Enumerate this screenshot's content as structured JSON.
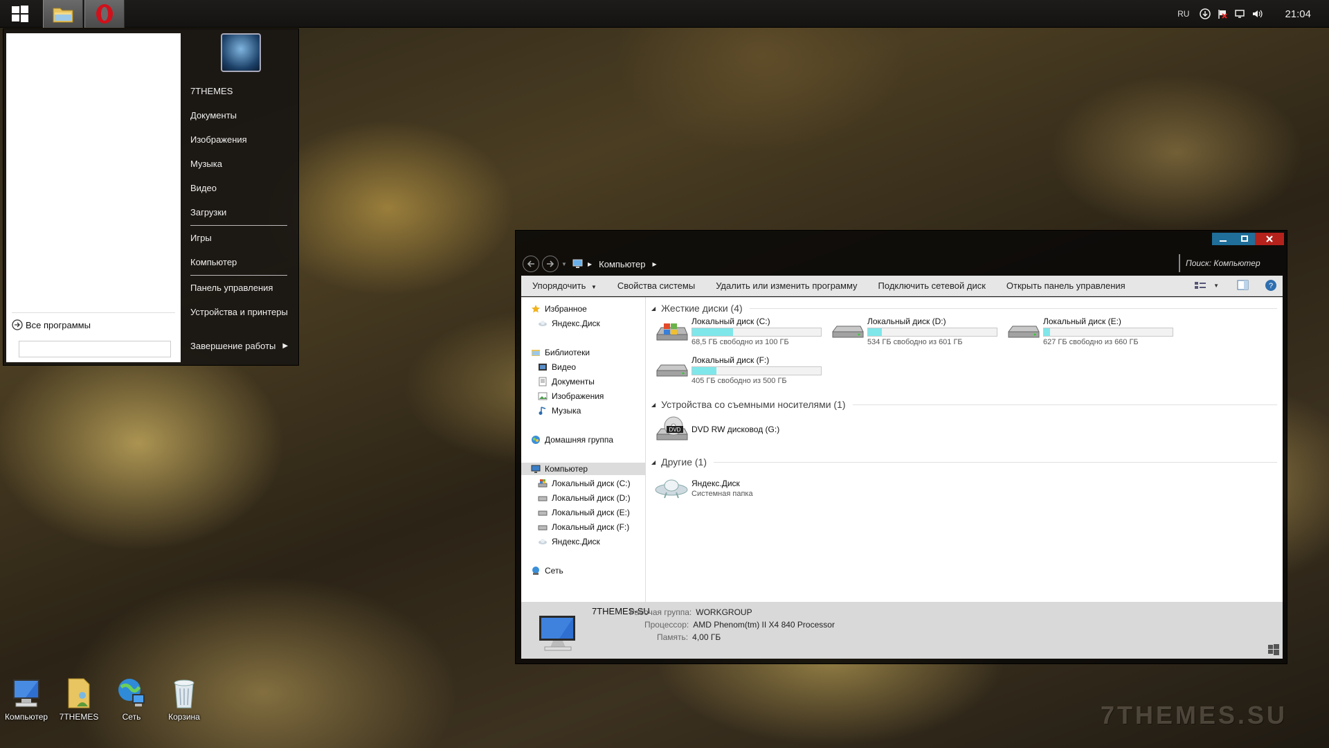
{
  "taskbar": {
    "pinned": [
      {
        "name": "explorer-taskbar-button",
        "icon": "folder-icon"
      },
      {
        "name": "opera-taskbar-button",
        "icon": "opera-icon"
      }
    ],
    "tray": {
      "language": "RU",
      "icons": [
        "download-icon",
        "action-center-flag-icon",
        "network-icon",
        "volume-icon"
      ],
      "clock": "21:04"
    }
  },
  "start_menu": {
    "all_programs": "Все программы",
    "search_placeholder": "",
    "user_name": "7THEMES",
    "items": {
      "documents": "Документы",
      "pictures": "Изображения",
      "music": "Музыка",
      "video": "Видео",
      "downloads": "Загрузки",
      "games": "Игры",
      "computer": "Компьютер",
      "control_panel": "Панель управления",
      "devices": "Устройства и принтеры",
      "shutdown": "Завершение работы"
    }
  },
  "explorer": {
    "breadcrumb": "Компьютер",
    "search_placeholder": "Поиск: Компьютер",
    "toolbar": {
      "organize": "Упорядочить",
      "system_properties": "Свойства системы",
      "uninstall": "Удалить или изменить программу",
      "map_drive": "Подключить сетевой диск",
      "control_panel": "Открыть панель управления"
    },
    "nav": {
      "favorites": "Избранное",
      "yandex_disk": "Яндекс.Диск",
      "libraries": "Библиотеки",
      "video": "Видео",
      "documents": "Документы",
      "pictures": "Изображения",
      "music": "Музыка",
      "homegroup": "Домашняя группа",
      "computer": "Компьютер",
      "drive_c": "Локальный диск (C:)",
      "drive_d": "Локальный диск (D:)",
      "drive_e": "Локальный диск (E:)",
      "drive_f": "Локальный диск (F:)",
      "yandex_disk2": "Яндекс.Диск",
      "network": "Сеть"
    },
    "groups": {
      "hard_drives": "Жесткие диски (4)",
      "removable": "Устройства со съемными носителями (1)",
      "other": "Другие (1)"
    },
    "drives": [
      {
        "name": "Локальный диск (C:)",
        "free": "68,5 ГБ свободно из 100 ГБ",
        "used_fraction": 0.315
      },
      {
        "name": "Локальный диск (D:)",
        "free": "534 ГБ свободно из 601 ГБ",
        "used_fraction": 0.11
      },
      {
        "name": "Локальный диск (E:)",
        "free": "627 ГБ свободно из 660 ГБ",
        "used_fraction": 0.05
      },
      {
        "name": "Локальный диск (F:)",
        "free": "405 ГБ свободно из 500 ГБ",
        "used_fraction": 0.19
      }
    ],
    "dvd": {
      "name": "DVD RW дисковод (G:)"
    },
    "yandex": {
      "name": "Яндекс.Диск",
      "sub": "Системная папка"
    },
    "details": {
      "computer_name": "7THEMES-SU",
      "workgroup_label": "Рабочая группа:",
      "workgroup": "WORKGROUP",
      "cpu_label": "Процессор:",
      "cpu": "AMD Phenom(tm) II X4 840 Processor",
      "ram_label": "Память:",
      "ram": "4,00 ГБ"
    }
  },
  "desktop_icons": {
    "computer": "Компьютер",
    "themes": "7THEMES",
    "network": "Сеть",
    "recycle": "Корзина"
  },
  "watermark": "7THEMES.SU"
}
